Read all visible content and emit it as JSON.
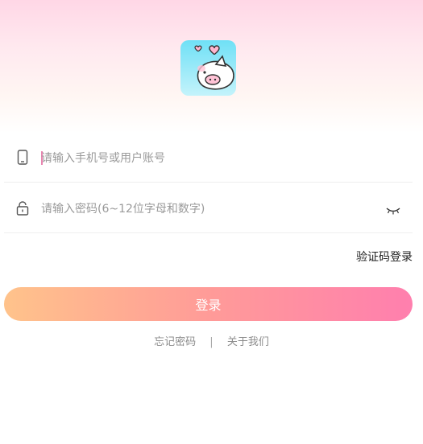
{
  "login_form": {
    "account_placeholder": "请输入手机号或用户账号",
    "password_placeholder": "请输入密码(6~12位字母和数字)",
    "code_login_label": "验证码登录",
    "login_button_label": "登录"
  },
  "footer": {
    "forgot_password_label": "忘记密码",
    "separator": "|",
    "about_us_label": "关于我们"
  },
  "colors": {
    "accent_pink": "#ff7fae",
    "accent_orange": "#ffc38b",
    "logo_background": "#7fe3f5"
  },
  "icons": {
    "account_field": "phone-icon",
    "password_field": "lock-icon",
    "password_toggle": "eye-closed-icon",
    "app_logo": "pig-heart-logo"
  }
}
